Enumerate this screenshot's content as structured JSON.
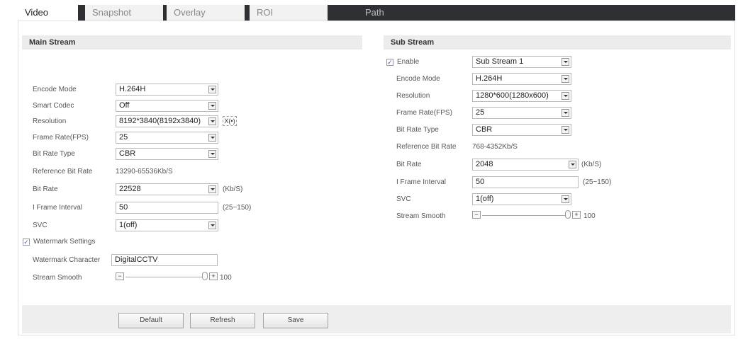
{
  "tabs": [
    {
      "label": "Video"
    },
    {
      "label": "Snapshot"
    },
    {
      "label": "Overlay"
    },
    {
      "label": "ROI"
    },
    {
      "label": "Path"
    }
  ],
  "main_stream": {
    "title": "Main Stream",
    "encode_mode": {
      "label": "Encode Mode",
      "value": "H.264H"
    },
    "smart_codec": {
      "label": "Smart Codec",
      "value": "Off"
    },
    "resolution": {
      "label": "Resolution",
      "value": "8192*3840(8192x3840)",
      "extra_button": "X(•)"
    },
    "frame_rate": {
      "label": "Frame Rate(FPS)",
      "value": "25"
    },
    "bit_rate_type": {
      "label": "Bit Rate Type",
      "value": "CBR"
    },
    "reference_bit_rate": {
      "label": "Reference Bit Rate",
      "value": "13290-65536Kb/S"
    },
    "bit_rate": {
      "label": "Bit Rate",
      "value": "22528",
      "unit": "(Kb/S)"
    },
    "iframe_interval": {
      "label": "I Frame Interval",
      "value": "50",
      "range": "(25~150)"
    },
    "svc": {
      "label": "SVC",
      "value": "1(off)"
    },
    "watermark_settings": {
      "label": "Watermark Settings",
      "checked": true
    },
    "watermark_character": {
      "label": "Watermark Character",
      "value": "DigitalCCTV"
    },
    "stream_smooth": {
      "label": "Stream Smooth",
      "value": "100",
      "level": 1.0
    }
  },
  "sub_stream": {
    "title": "Sub Stream",
    "enable": {
      "label": "Enable",
      "checked": true,
      "value": "Sub Stream 1"
    },
    "encode_mode": {
      "label": "Encode Mode",
      "value": "H.264H"
    },
    "resolution": {
      "label": "Resolution",
      "value": "1280*600(1280x600)"
    },
    "frame_rate": {
      "label": "Frame Rate(FPS)",
      "value": "25"
    },
    "bit_rate_type": {
      "label": "Bit Rate Type",
      "value": "CBR"
    },
    "reference_bit_rate": {
      "label": "Reference Bit Rate",
      "value": "768-4352Kb/S"
    },
    "bit_rate": {
      "label": "Bit Rate",
      "value": "2048",
      "unit": "(Kb/S)"
    },
    "iframe_interval": {
      "label": "I Frame Interval",
      "value": "50",
      "range": "(25~150)"
    },
    "svc": {
      "label": "SVC",
      "value": "1(off)"
    },
    "stream_smooth": {
      "label": "Stream Smooth",
      "value": "100",
      "level": 1.0
    }
  },
  "buttons": {
    "default": "Default",
    "refresh": "Refresh",
    "save": "Save"
  },
  "icons": {
    "checkbox": "checkbox-checked-icon",
    "dropdown": "chevron-down-icon",
    "minus": "minus-icon",
    "plus": "plus-icon"
  },
  "colors": {
    "tab_bar": "#2f3033",
    "section_header": "#ececec",
    "footer": "#eeeeee"
  }
}
